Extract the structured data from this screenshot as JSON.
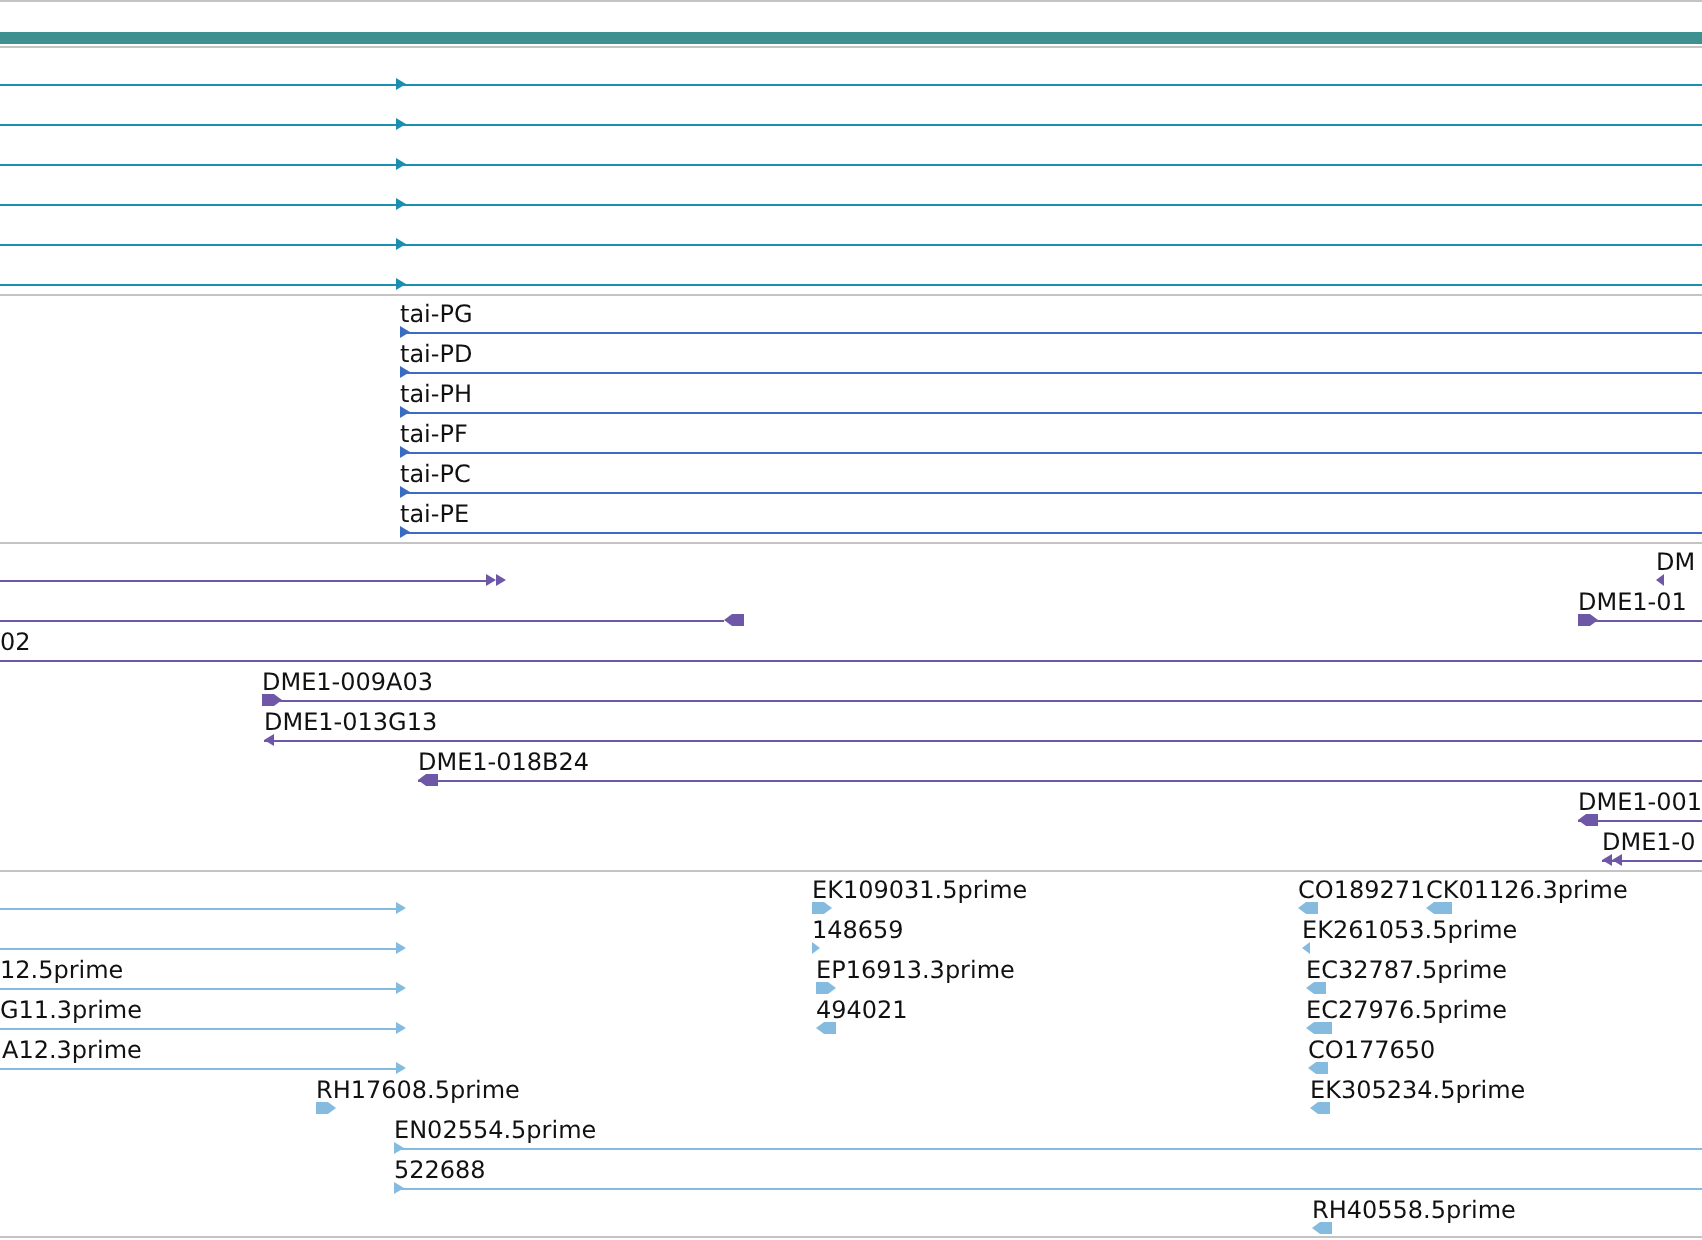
{
  "tracks": [
    {
      "features": [
        {
          "reverse": false
        },
        {
          "reverse": false
        },
        {
          "reverse": false
        },
        {
          "reverse": false
        },
        {
          "reverse": false
        },
        {
          "reverse": false
        }
      ]
    },
    {
      "features": [
        {
          "label": "tai-PG",
          "reverse": false
        },
        {
          "label": "tai-PD",
          "reverse": false
        },
        {
          "label": "tai-PH",
          "reverse": false
        },
        {
          "label": "tai-PF",
          "reverse": false
        },
        {
          "label": "tai-PC",
          "reverse": false
        },
        {
          "label": "tai-PE",
          "reverse": false
        }
      ]
    },
    {
      "features": [
        {
          "reverse": false,
          "double": true
        },
        {
          "label": "DM",
          "reverse": true,
          "double": false
        },
        {
          "reverse": true,
          "double": false
        },
        {
          "label": "DME1-01",
          "reverse": false,
          "double": false
        },
        {
          "label": "02"
        },
        {
          "label": "DME1-009A03",
          "reverse": false,
          "double": false
        },
        {
          "label": "DME1-013G13",
          "reverse": true,
          "double": false
        },
        {
          "label": "DME1-018B24",
          "reverse": true,
          "double": false
        },
        {
          "label": "DME1-001",
          "reverse": true,
          "double": false
        },
        {
          "label": "DME1-0",
          "reverse": true,
          "double": true
        }
      ]
    },
    {
      "features": [
        {
          "reverse": false
        },
        {
          "reverse": false
        },
        {
          "label": "12.5prime",
          "reverse": false
        },
        {
          "label": "G11.3prime",
          "reverse": false
        },
        {
          "label": "A12.3prime",
          "reverse": false
        },
        {
          "label": "RH17608.5prime",
          "reverse": false
        },
        {
          "label": "EN02554.5prime",
          "reverse": false
        },
        {
          "label": "522688",
          "reverse": false
        },
        {
          "label": "EK109031.5prime",
          "reverse": false
        },
        {
          "label": "148659",
          "reverse": false
        },
        {
          "label": "EP16913.3prime",
          "reverse": false
        },
        {
          "label": "494021",
          "reverse": true
        },
        {
          "label": "CO189271",
          "reverse": true
        },
        {
          "label": "CK01126.3prime",
          "reverse": true
        },
        {
          "label": "EK261053.5prime",
          "reverse": true
        },
        {
          "label": "EC32787.5prime",
          "reverse": true
        },
        {
          "label": "EC27976.5prime",
          "reverse": true
        },
        {
          "label": "CO177650",
          "reverse": true
        },
        {
          "label": "EK305234.5prime",
          "reverse": true
        },
        {
          "label": "RH40558.5prime",
          "reverse": true
        }
      ]
    }
  ]
}
